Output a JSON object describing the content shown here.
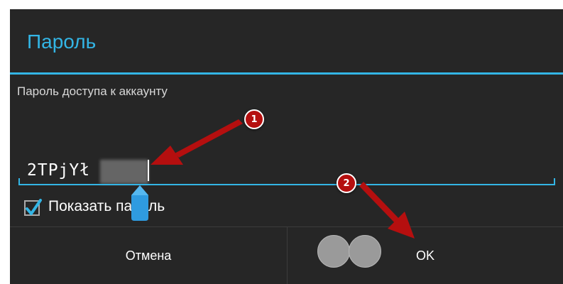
{
  "dialog": {
    "title": "Пароль",
    "field_label": "Пароль доступа к аккаунту",
    "password_value": "2TPjYł",
    "show_password_label": "Показать пароль",
    "show_password_checked": true,
    "cancel_label": "Отмена",
    "ok_label": "OK"
  },
  "annotations": {
    "badge_1": "1",
    "badge_2": "2"
  },
  "colors": {
    "accent": "#33b5e5",
    "background": "#262626",
    "annotation_red": "#b50f0f"
  }
}
